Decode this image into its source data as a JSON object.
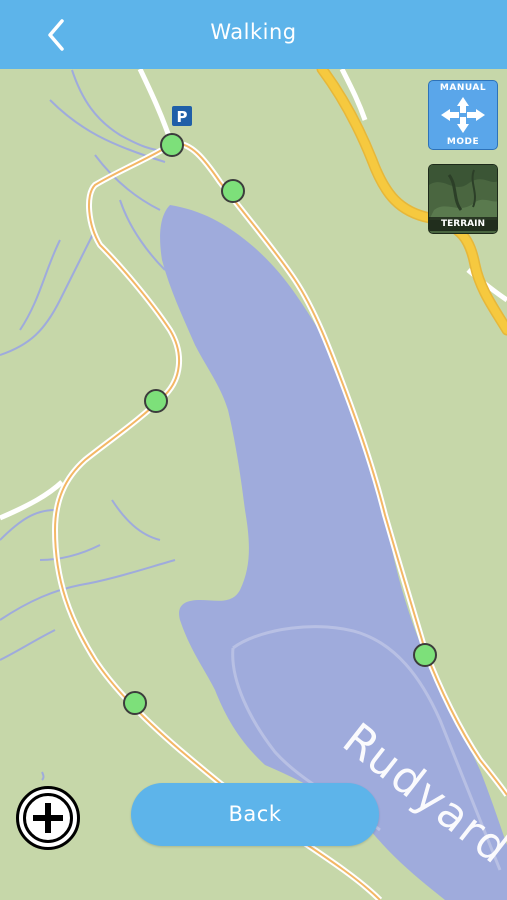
{
  "header": {
    "title": "Walking",
    "back_icon": "chevron-left-icon",
    "background": "#5db4ea"
  },
  "map": {
    "water_label": "Rudyard",
    "parking_label": "P",
    "waypoint_color": "#7de07a",
    "water_color": "#9fabdc",
    "land_color": "#c6d7a9",
    "road_color": "#f6c93f"
  },
  "controls": {
    "manual_mode": {
      "label_top": "MANUAL",
      "label_bottom": "MODE"
    },
    "terrain": {
      "label": "TERRAIN"
    },
    "add_icon": "plus-circle-icon"
  },
  "footer": {
    "back_label": "Back"
  }
}
